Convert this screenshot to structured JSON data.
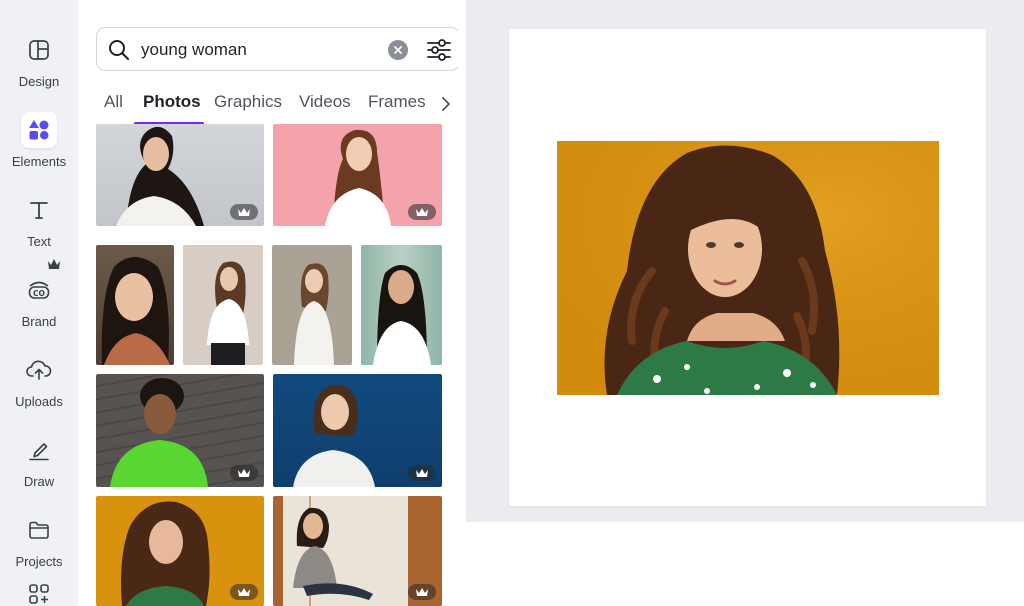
{
  "rail": {
    "items": [
      {
        "label": "Design",
        "icon": "layout-icon"
      },
      {
        "label": "Elements",
        "icon": "shapes-icon"
      },
      {
        "label": "Text",
        "icon": "text-icon"
      },
      {
        "label": "Brand",
        "icon": "brand-kit-icon"
      },
      {
        "label": "Uploads",
        "icon": "cloud-upload-icon"
      },
      {
        "label": "Draw",
        "icon": "pen-icon"
      },
      {
        "label": "Projects",
        "icon": "folder-icon"
      }
    ],
    "accent": "#5b4cf5"
  },
  "search": {
    "value": "young woman",
    "placeholder": ""
  },
  "tabs": {
    "items": [
      "All",
      "Photos",
      "Graphics",
      "Videos",
      "Frames"
    ],
    "active": "Photos",
    "accent": "#7d2ae8"
  },
  "results": {
    "photos": [
      {
        "description_icon": "photo-thumbnail",
        "premium": true
      },
      {
        "description_icon": "photo-thumbnail",
        "premium": true
      },
      {
        "description_icon": "photo-thumbnail",
        "premium": false
      },
      {
        "description_icon": "photo-thumbnail",
        "premium": false
      },
      {
        "description_icon": "photo-thumbnail",
        "premium": false
      },
      {
        "description_icon": "photo-thumbnail",
        "premium": false
      },
      {
        "description_icon": "photo-thumbnail",
        "premium": true
      },
      {
        "description_icon": "photo-thumbnail",
        "premium": true
      },
      {
        "description_icon": "photo-thumbnail",
        "premium": true
      },
      {
        "description_icon": "photo-thumbnail",
        "premium": true
      }
    ]
  },
  "canvas": {
    "background": "#ebecf0",
    "page_color": "#ffffff",
    "image_backdrop": "#d9920e"
  }
}
